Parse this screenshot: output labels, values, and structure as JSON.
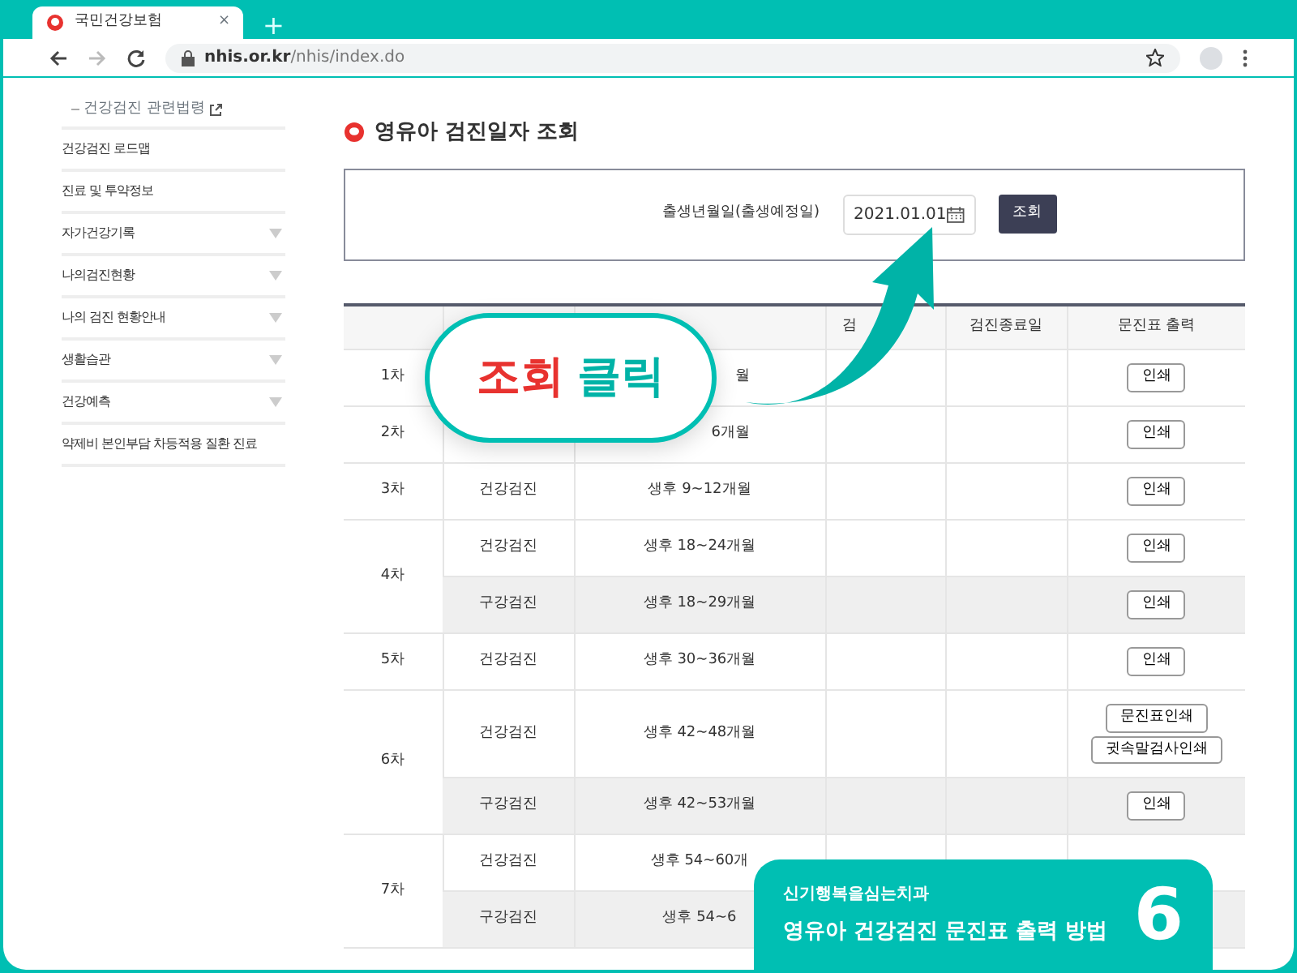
{
  "browser": {
    "tab_title": "국민건강보험",
    "new_tab": "+",
    "close": "×",
    "url_host": "nhis.or.kr",
    "url_path": "/nhis/index.do"
  },
  "sidebar": {
    "sub_link": "건강검진 관련법령",
    "items": [
      {
        "label": "건강검진 로드맵",
        "expandable": false
      },
      {
        "label": "진료 및 투약정보",
        "expandable": false
      },
      {
        "label": "자가건강기록",
        "expandable": true
      },
      {
        "label": "나의검진현황",
        "expandable": true
      },
      {
        "label": "나의 검진 현황안내",
        "expandable": true
      },
      {
        "label": "생활습관",
        "expandable": true
      },
      {
        "label": "건강예측",
        "expandable": true
      },
      {
        "label": "약제비 본인부담 차등적용 질환 진료",
        "expandable": false
      }
    ]
  },
  "title": "영유아 검진일자 조회",
  "search": {
    "label": "출생년월일(출생예정일)",
    "date": "2021.01.01",
    "button": "조회"
  },
  "table": {
    "columns": [
      {},
      {},
      {},
      {
        "label": "검"
      },
      {
        "label": "검진종료일"
      },
      {
        "label": "문진표 출력"
      }
    ],
    "groups": [
      {
        "round": "1차",
        "items": [
          {
            "age": "월",
            "shaded": false,
            "print": [
              "인쇄"
            ]
          }
        ]
      },
      {
        "round": "2차",
        "items": [
          {
            "age": "6개월",
            "shaded": false,
            "print": [
              "인쇄"
            ]
          }
        ]
      },
      {
        "round": "3차",
        "items": [
          {
            "type": "건강검진",
            "age": "생후 9~12개월",
            "shaded": false,
            "print": [
              "인쇄"
            ]
          }
        ]
      },
      {
        "round": "4차",
        "items": [
          {
            "type": "건강검진",
            "age": "생후 18~24개월",
            "shaded": false,
            "print": [
              "인쇄"
            ]
          },
          {
            "type": "구강검진",
            "age": "생후 18~29개월",
            "shaded": true,
            "print": [
              "인쇄"
            ]
          }
        ]
      },
      {
        "round": "5차",
        "items": [
          {
            "type": "건강검진",
            "age": "생후 30~36개월",
            "shaded": false,
            "print": [
              "인쇄"
            ]
          }
        ]
      },
      {
        "round": "6차",
        "items": [
          {
            "type": "건강검진",
            "age": "생후 42~48개월",
            "shaded": false,
            "print": [
              "문진표인쇄",
              "귓속말검사인쇄"
            ]
          },
          {
            "type": "구강검진",
            "age": "생후 42~53개월",
            "shaded": true,
            "print": [
              "인쇄"
            ]
          }
        ]
      },
      {
        "round": "7차",
        "items": [
          {
            "type": "건강검진",
            "age": "생후 54~60개",
            "shaded": false
          },
          {
            "type": "구강검진",
            "age": "생후 54~6",
            "shaded": true
          }
        ]
      }
    ]
  },
  "callout": {
    "highlight": "조회",
    "rest": "클릭"
  },
  "banner": {
    "subtitle": "신기행복을심는치과",
    "title": "영유아 건강검진 문진표 출력 방법",
    "number": "6"
  }
}
